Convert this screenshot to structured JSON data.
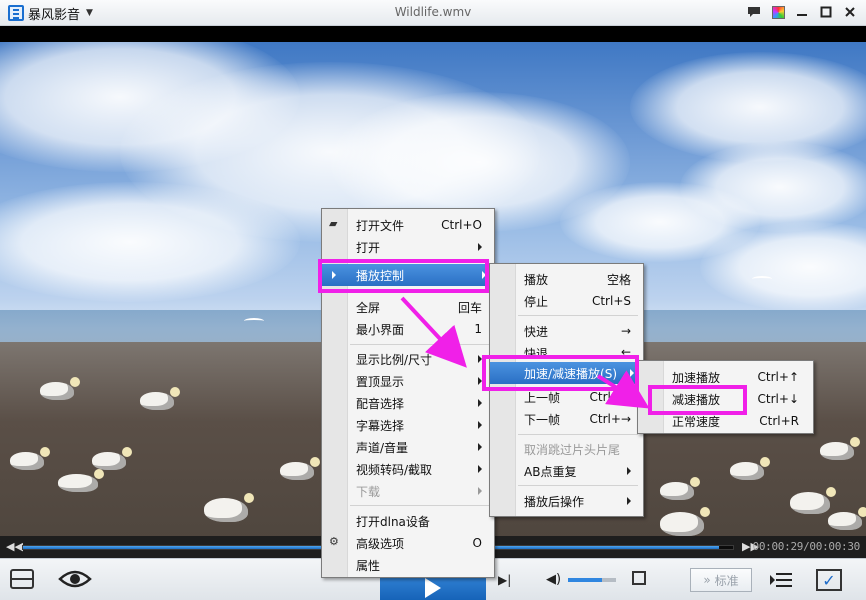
{
  "app": {
    "name": "暴风影音",
    "window_title": "Wildlife.wmv",
    "title_buttons": [
      "message-icon",
      "skin-icon",
      "minimize-icon",
      "maximize-icon",
      "close-icon"
    ]
  },
  "progress": {
    "fraction": 0.98,
    "time_display": "00:00:29/00:00:30"
  },
  "bottom_bar": {
    "standard_label": "标准",
    "volume_fraction": 0.7
  },
  "context_menu": {
    "items": [
      {
        "label": "打开文件",
        "shortcut": "Ctrl+O"
      },
      {
        "label": "打开",
        "shortcut": ""
      },
      {
        "label": "播放控制",
        "shortcut": ""
      },
      {
        "label": "全屏",
        "shortcut": "回车"
      },
      {
        "label": "最小界面",
        "shortcut": "1"
      },
      {
        "label": "显示比例/尺寸",
        "shortcut": ""
      },
      {
        "label": "置顶显示",
        "shortcut": ""
      },
      {
        "label": "配音选择",
        "shortcut": ""
      },
      {
        "label": "字幕选择",
        "shortcut": ""
      },
      {
        "label": "声道/音量",
        "shortcut": ""
      },
      {
        "label": "视频转码/截取",
        "shortcut": ""
      },
      {
        "label": "下载",
        "shortcut": ""
      },
      {
        "label": "打开dlna设备",
        "shortcut": ""
      },
      {
        "label": "高级选项",
        "shortcut": "O"
      },
      {
        "label": "属性",
        "shortcut": ""
      }
    ]
  },
  "playback_menu": {
    "items": [
      {
        "label": "播放",
        "shortcut": "空格"
      },
      {
        "label": "停止",
        "shortcut": "Ctrl+S"
      },
      {
        "label": "快进",
        "shortcut": "→"
      },
      {
        "label": "快退",
        "shortcut": "←"
      },
      {
        "label": "加速/减速播放(S)",
        "shortcut": ""
      },
      {
        "label": "上一帧",
        "shortcut": "Ctrl+←"
      },
      {
        "label": "下一帧",
        "shortcut": "Ctrl+→"
      },
      {
        "label": "取消跳过片头片尾",
        "shortcut": ""
      },
      {
        "label": "AB点重复",
        "shortcut": ""
      },
      {
        "label": "播放后操作",
        "shortcut": ""
      }
    ]
  },
  "speed_menu": {
    "items": [
      {
        "label": "加速播放",
        "shortcut": "Ctrl+↑"
      },
      {
        "label": "减速播放",
        "shortcut": "Ctrl+↓"
      },
      {
        "label": "正常速度",
        "shortcut": "Ctrl+R"
      }
    ]
  },
  "colors": {
    "highlight_box": "#f020e8",
    "menu_selection": "#2a6fc4",
    "accent_blue": "#1d6fc4"
  }
}
